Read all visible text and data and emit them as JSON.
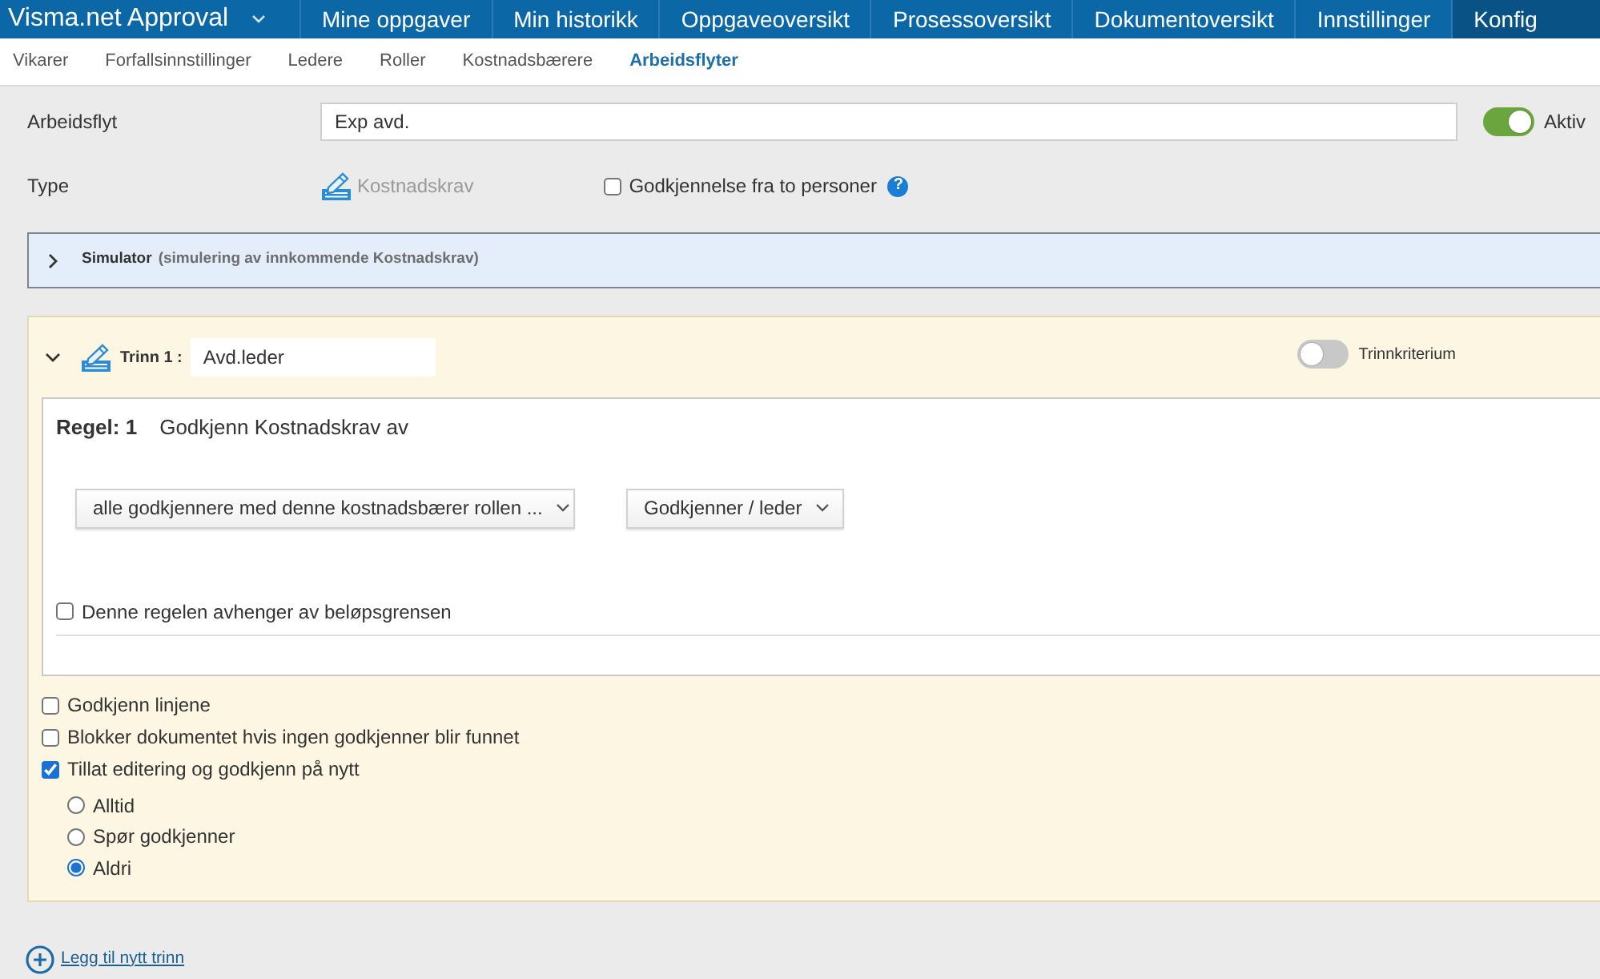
{
  "top_nav": {
    "app_title": "Visma.net Approval",
    "items": [
      {
        "label": "Mine oppgaver",
        "selected": false
      },
      {
        "label": "Min historikk",
        "selected": false
      },
      {
        "label": "Oppgaveoversikt",
        "selected": false
      },
      {
        "label": "Prosessoversikt",
        "selected": false
      },
      {
        "label": "Dokumentoversikt",
        "selected": false
      },
      {
        "label": "Innstillinger",
        "selected": false
      },
      {
        "label": "Konfig",
        "selected": true
      }
    ]
  },
  "sub_nav": [
    {
      "label": "Vikarer",
      "selected": false
    },
    {
      "label": "Forfallsinnstillinger",
      "selected": false
    },
    {
      "label": "Ledere",
      "selected": false
    },
    {
      "label": "Roller",
      "selected": false
    },
    {
      "label": "Kostnadsbærere",
      "selected": false
    },
    {
      "label": "Arbeidsflyter",
      "selected": true
    }
  ],
  "workflow": {
    "label": "Arbeidsflyt",
    "value": "Exp avd.",
    "active": {
      "label": "Aktiv",
      "on": true
    }
  },
  "type": {
    "label": "Type",
    "value": "Kostnadskrav",
    "two_person": {
      "label": "Godkjennelse fra to personer",
      "checked": false
    },
    "help": "?"
  },
  "simulator": {
    "title": "Simulator",
    "subtitle": "(simulering av innkommende Kostnadskrav)",
    "expanded": false
  },
  "step": {
    "expanded": true,
    "label": "Trinn 1 :",
    "name": "Avd.leder",
    "criterion": {
      "label": "Trinnkriterium",
      "on": false
    },
    "rule": {
      "label": "Regel: 1",
      "text": "Godkjenn Kostnadskrav av",
      "dropdowns": [
        "alle godkjennere med denne kostnadsbærer rollen ...",
        "Godkjenner / leder"
      ],
      "amount_limit": {
        "label": "Denne regelen avhenger av beløpsgrensen",
        "checked": false
      }
    },
    "options": [
      {
        "label": "Godkjenn linjene",
        "checked": false
      },
      {
        "label": "Blokker dokumentet hvis ingen godkjenner blir funnet",
        "checked": false
      },
      {
        "label": "Tillat editering og godkjenn på nytt",
        "checked": true
      }
    ],
    "reapproval": [
      {
        "label": "Alltid",
        "selected": false
      },
      {
        "label": "Spør godkjenner",
        "selected": false
      },
      {
        "label": "Aldri",
        "selected": true
      }
    ]
  },
  "add_step": {
    "label": "Legg til nytt trinn"
  }
}
